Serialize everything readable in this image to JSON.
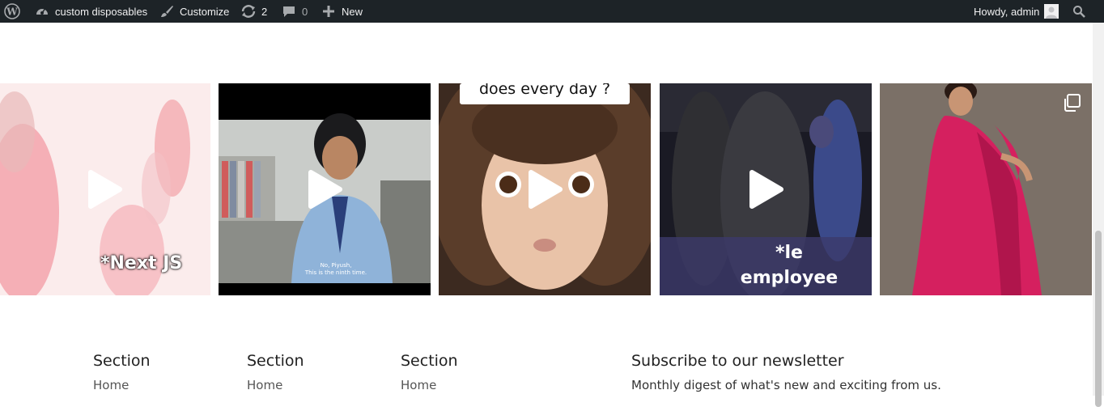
{
  "admin_bar": {
    "wp_logo_icon": "wordpress-logo-icon",
    "site_name": "custom disposables",
    "customize_label": "Customize",
    "updates_count": "2",
    "comments_count": "0",
    "new_label": "New",
    "greeting": "Howdy, admin"
  },
  "gallery": {
    "tiles": [
      {
        "type": "video",
        "caption": "*Next JS"
      },
      {
        "type": "video",
        "subtitle_line1": "No, Piyush,",
        "subtitle_line2": "This is the ninth time."
      },
      {
        "type": "video",
        "caption": "does every day ?"
      },
      {
        "type": "video",
        "caption_line1": "*le",
        "caption_line2": "employee"
      },
      {
        "type": "carousel"
      }
    ]
  },
  "footer": {
    "columns": [
      {
        "title": "Section",
        "links": [
          "Home"
        ]
      },
      {
        "title": "Section",
        "links": [
          "Home"
        ]
      },
      {
        "title": "Section",
        "links": [
          "Home"
        ]
      }
    ],
    "newsletter": {
      "title": "Subscribe to our newsletter",
      "description": "Monthly digest of what's new and exciting from us."
    }
  }
}
